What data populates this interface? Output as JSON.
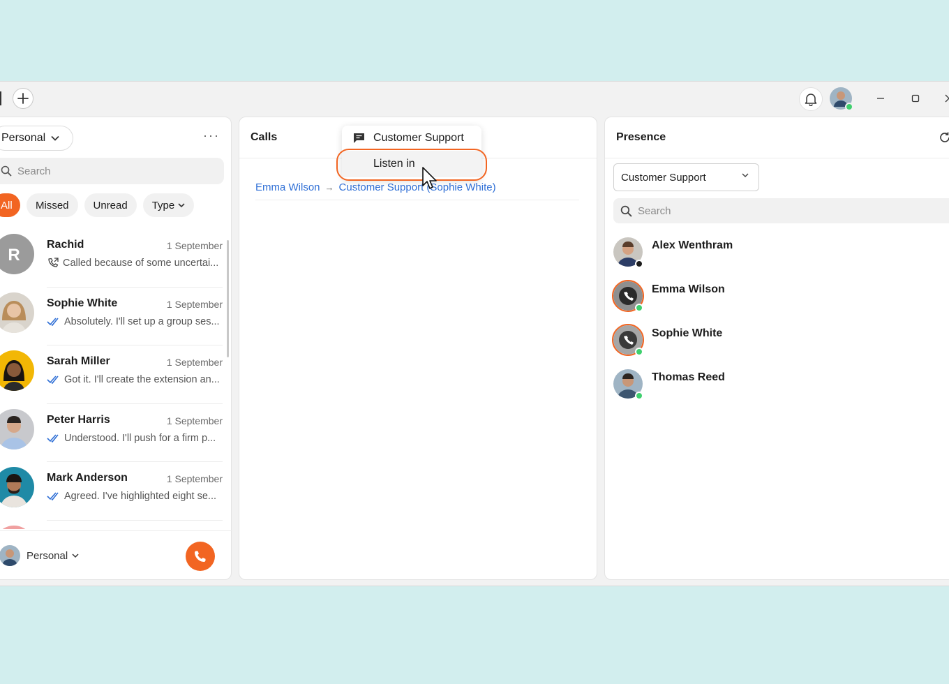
{
  "titlebar": {
    "new_icon": "plus-icon",
    "notifications_icon": "bell-icon",
    "minimize_icon": "minimize-icon",
    "maximize_icon": "maximize-icon",
    "close_icon": "close-icon"
  },
  "left": {
    "scope_label": "Personal",
    "search_placeholder": "Search",
    "chips": [
      "All",
      "Missed",
      "Unread",
      "Type"
    ],
    "conversations": [
      {
        "name": "Rachid",
        "date": "1 September",
        "preview": "Called because of some uncertai...",
        "icon": "outgoing-call-icon",
        "initial": "R"
      },
      {
        "name": "Sophie White",
        "date": "1 September",
        "preview": "Absolutely. I'll set up a group ses...",
        "icon": "double-check-icon"
      },
      {
        "name": "Sarah Miller",
        "date": "1 September",
        "preview": "Got it. I'll create the extension an...",
        "icon": "double-check-icon"
      },
      {
        "name": "Peter Harris",
        "date": "1 September",
        "preview": "Understood. I'll push for a firm p...",
        "icon": "double-check-icon"
      },
      {
        "name": "Mark Anderson",
        "date": "1 September",
        "preview": "Agreed. I've highlighted eight se...",
        "icon": "double-check-icon"
      }
    ],
    "footer_scope": "Personal"
  },
  "middle": {
    "title": "Calls",
    "call_from": "Emma Wilson",
    "call_to": "Customer Support (Sophie White)"
  },
  "dropdown": {
    "header": "Customer Support",
    "item": "Listen in"
  },
  "right": {
    "title": "Presence",
    "queue": "Customer Support",
    "search_placeholder": "Search",
    "people": [
      {
        "name": "Alex Wenthram",
        "status": "away",
        "on_call": false
      },
      {
        "name": "Emma Wilson",
        "status": "online",
        "on_call": true
      },
      {
        "name": "Sophie White",
        "status": "online",
        "on_call": true
      },
      {
        "name": "Thomas Reed",
        "status": "online",
        "on_call": false
      }
    ]
  },
  "colors": {
    "accent": "#f26522",
    "link": "#2f6fd6",
    "online": "#3fd06e",
    "background": "#d2eeee"
  }
}
